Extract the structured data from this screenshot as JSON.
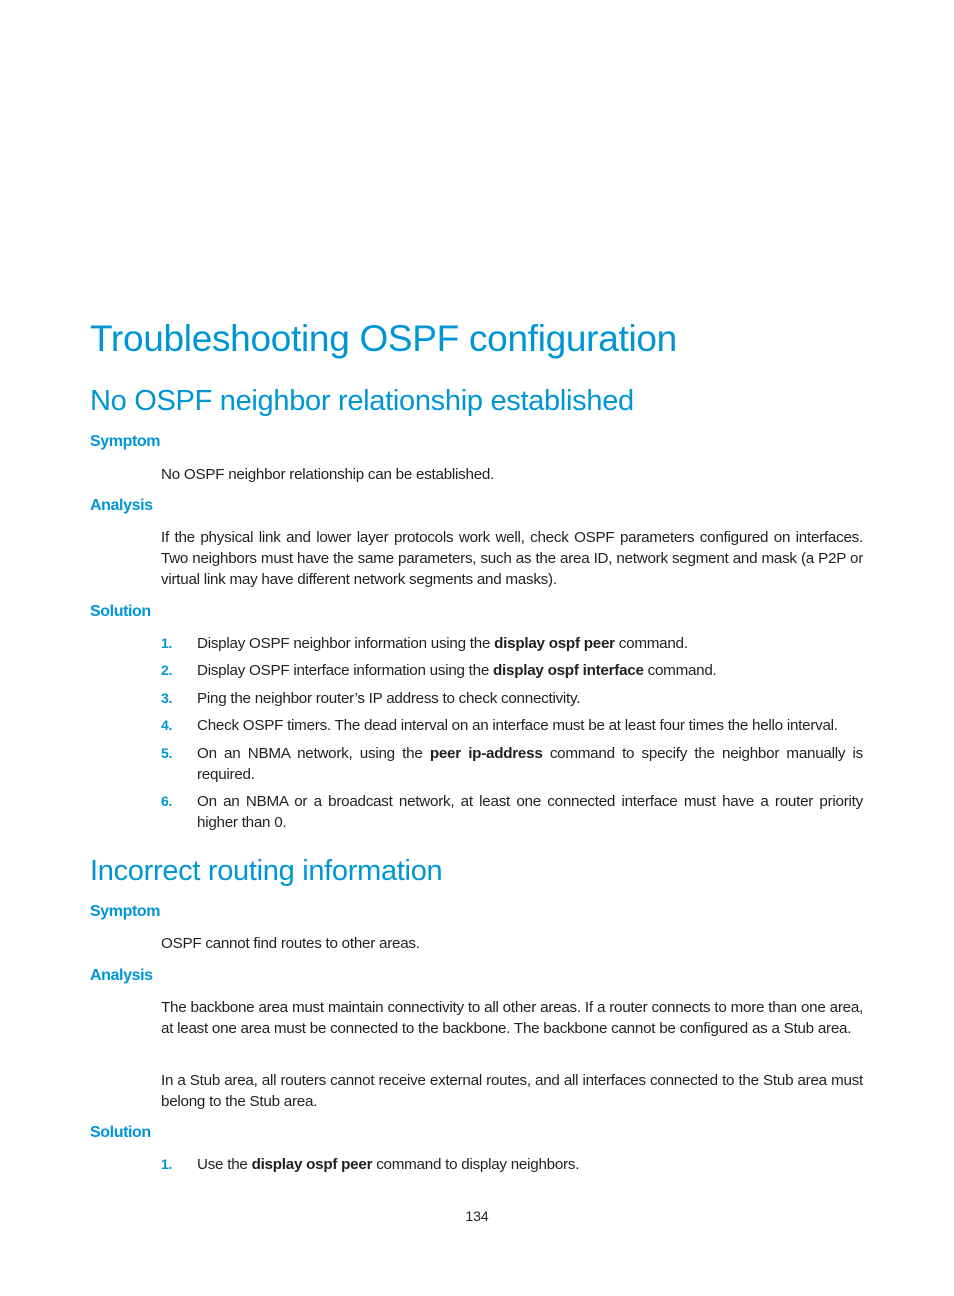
{
  "document": {
    "title": "Troubleshooting OSPF configuration",
    "page_number": "134",
    "accent_color": "#0096d6",
    "sections": [
      {
        "heading": "No OSPF neighbor relationship established",
        "symptom": {
          "label": "Symptom",
          "text": "No OSPF neighbor relationship can be established."
        },
        "analysis": {
          "label": "Analysis",
          "paragraphs": [
            "If the physical link and lower layer protocols work well, check OSPF parameters configured on interfaces. Two neighbors must have the same parameters, such as the area ID, network segment and mask (a P2P or virtual link may have different network segments and masks)."
          ]
        },
        "solution": {
          "label": "Solution",
          "steps": [
            {
              "num": "1.",
              "pre": "Display OSPF neighbor information using the ",
              "cmd": "display ospf peer",
              "post": " command."
            },
            {
              "num": "2.",
              "pre": "Display OSPF interface information using the ",
              "cmd": "display ospf interface",
              "post": " command."
            },
            {
              "num": "3.",
              "pre": "Ping the neighbor router’s IP address to check connectivity.",
              "cmd": "",
              "post": ""
            },
            {
              "num": "4.",
              "pre": "Check OSPF timers. The dead interval on an interface must be at least four times the hello interval.",
              "cmd": "",
              "post": ""
            },
            {
              "num": "5.",
              "pre": "On an NBMA network, using the ",
              "cmd": "peer ip-address",
              "post": " command to specify the neighbor manually is required."
            },
            {
              "num": "6.",
              "pre": "On an NBMA or a broadcast network, at least one connected interface must have a router priority higher than 0.",
              "cmd": "",
              "post": ""
            }
          ]
        }
      },
      {
        "heading": "Incorrect routing information",
        "symptom": {
          "label": "Symptom",
          "text": "OSPF cannot find routes to other areas."
        },
        "analysis": {
          "label": "Analysis",
          "paragraphs": [
            "The backbone area must maintain connectivity to all other areas. If a router connects to more than one area, at least one area must be connected to the backbone. The backbone cannot be configured as a Stub area.",
            "In a Stub area, all routers cannot receive external routes, and all interfaces connected to the Stub area must belong to the Stub area."
          ]
        },
        "solution": {
          "label": "Solution",
          "steps": [
            {
              "num": "1.",
              "pre": "Use the ",
              "cmd": "display ospf peer",
              "post": " command to display neighbors."
            }
          ]
        }
      }
    ]
  }
}
